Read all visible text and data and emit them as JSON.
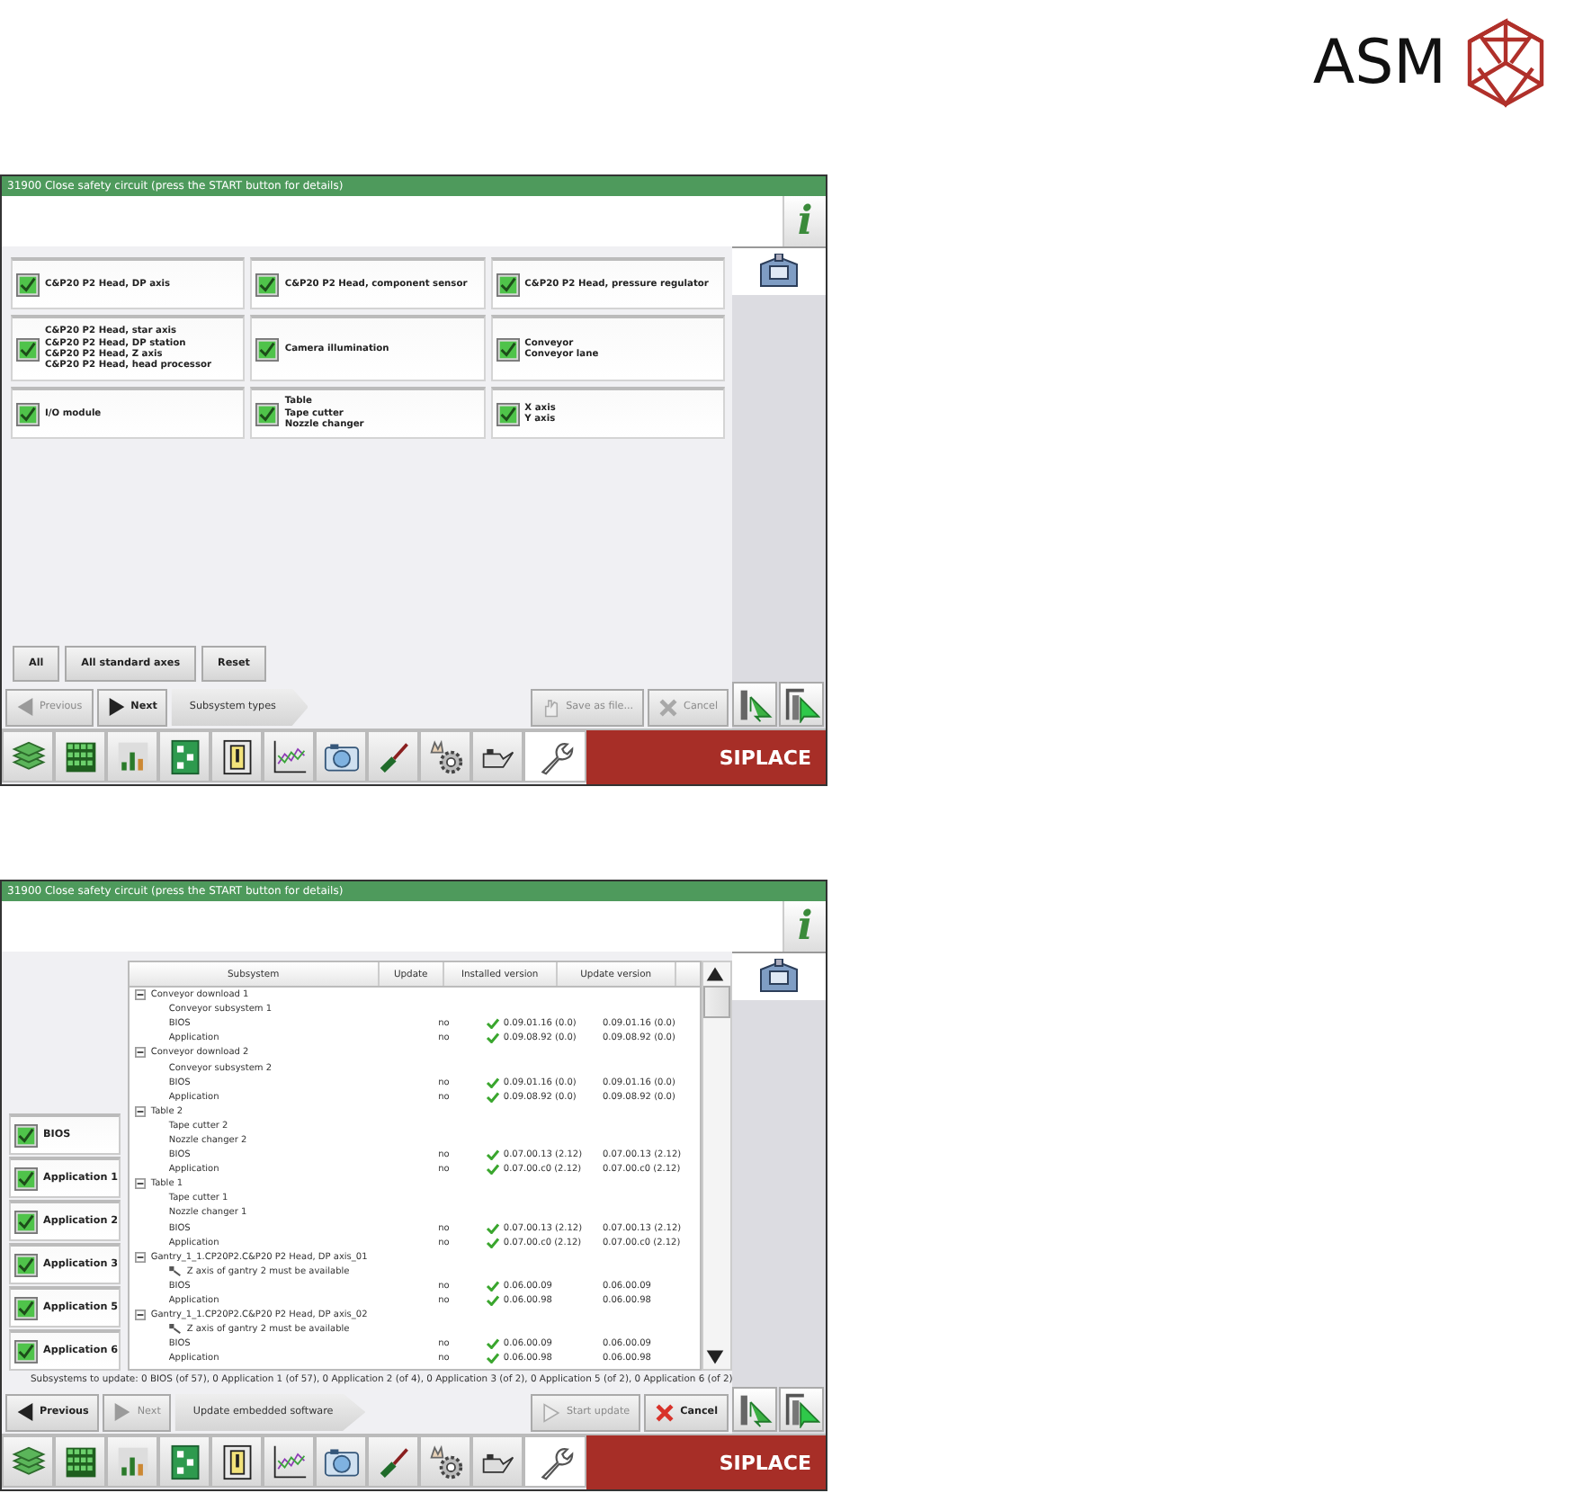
{
  "logo": {
    "text": "ASM"
  },
  "screens": [
    {
      "kind": "subsystem_types",
      "title": "31900 Close safety circuit (press the START button for details)",
      "info": "i",
      "tiles": [
        {
          "checked": true,
          "lines": [
            "C&P20 P2 Head, DP axis"
          ]
        },
        {
          "checked": true,
          "lines": [
            "C&P20 P2 Head, component sensor"
          ]
        },
        {
          "checked": true,
          "lines": [
            "C&P20 P2 Head, pressure regulator"
          ]
        },
        {
          "checked": true,
          "lines": [
            "C&P20 P2 Head, star axis",
            "C&P20 P2 Head, DP station",
            "C&P20 P2 Head, Z axis",
            "C&P20 P2 Head, head processor"
          ]
        },
        {
          "checked": true,
          "lines": [
            "Camera illumination"
          ]
        },
        {
          "checked": true,
          "lines": [
            "Conveyor",
            "Conveyor lane"
          ]
        },
        {
          "checked": true,
          "lines": [
            "I/O module"
          ]
        },
        {
          "checked": true,
          "lines": [
            "Table",
            "Tape cutter",
            "Nozzle changer"
          ]
        },
        {
          "checked": true,
          "lines": [
            "X axis",
            "Y axis"
          ]
        }
      ],
      "select_buttons": [
        "All",
        "All standard axes",
        "Reset"
      ],
      "nav": {
        "previous": {
          "label": "Previous",
          "disabled": true
        },
        "next": {
          "label": "Next",
          "disabled": false
        },
        "step": "Subsystem types",
        "actions": [
          {
            "kind": "save",
            "label": "Save as file...",
            "disabled": true
          },
          {
            "kind": "cancel",
            "label": "Cancel",
            "disabled": true
          }
        ]
      },
      "taskbar": [
        {
          "kind": "stack",
          "selected": false
        },
        {
          "kind": "grid",
          "selected": false
        },
        {
          "kind": "bars",
          "selected": false
        },
        {
          "kind": "board",
          "selected": false
        },
        {
          "kind": "door",
          "selected": false
        },
        {
          "kind": "linechart",
          "selected": false
        },
        {
          "kind": "camera",
          "selected": false
        },
        {
          "kind": "screwdriver",
          "selected": false
        },
        {
          "kind": "handgear",
          "selected": false
        },
        {
          "kind": "oilcan",
          "selected": false
        },
        {
          "kind": "wrench",
          "selected": true
        }
      ],
      "brand": "SIPLACE"
    },
    {
      "kind": "embedded_update",
      "title": "31900 Close safety circuit (press the START button for details)",
      "info": "i",
      "options": [
        {
          "label": "BIOS",
          "checked": true
        },
        {
          "label": "Application 1",
          "checked": true
        },
        {
          "label": "Application 2",
          "checked": true
        },
        {
          "label": "Application 3",
          "checked": true
        },
        {
          "label": "Application 5",
          "checked": true
        },
        {
          "label": "Application 6",
          "checked": true
        }
      ],
      "table": {
        "columns": [
          "Subsystem",
          "Update",
          "Installed version",
          "Update version"
        ],
        "rows": [
          {
            "name": "Conveyor download 1",
            "expanded": true,
            "children": [
              {
                "kind": "node",
                "name": "Conveyor subsystem 1"
              },
              {
                "kind": "module",
                "name": "BIOS",
                "update": "no",
                "installed": "0.09.01.16 (0.0)",
                "update_version": "0.09.01.16 (0.0)"
              },
              {
                "kind": "module",
                "name": "Application",
                "update": "no",
                "installed": "0.09.08.92 (0.0)",
                "update_version": "0.09.08.92 (0.0)"
              }
            ]
          },
          {
            "name": "Conveyor download 2",
            "expanded": true,
            "children": [
              {
                "kind": "node",
                "name": "Conveyor subsystem 2"
              },
              {
                "kind": "module",
                "name": "BIOS",
                "update": "no",
                "installed": "0.09.01.16 (0.0)",
                "update_version": "0.09.01.16 (0.0)"
              },
              {
                "kind": "module",
                "name": "Application",
                "update": "no",
                "installed": "0.09.08.92 (0.0)",
                "update_version": "0.09.08.92 (0.0)"
              }
            ]
          },
          {
            "name": "Table 2",
            "expanded": true,
            "children": [
              {
                "kind": "node",
                "name": "Tape cutter 2"
              },
              {
                "kind": "node",
                "name": "Nozzle changer 2"
              },
              {
                "kind": "module",
                "name": "BIOS",
                "update": "no",
                "installed": "0.07.00.13 (2.12)",
                "update_version": "0.07.00.13 (2.12)"
              },
              {
                "kind": "module",
                "name": "Application",
                "update": "no",
                "installed": "0.07.00.c0 (2.12)",
                "update_version": "0.07.00.c0 (2.12)"
              }
            ]
          },
          {
            "name": "Table 1",
            "expanded": true,
            "children": [
              {
                "kind": "node",
                "name": "Tape cutter 1"
              },
              {
                "kind": "node",
                "name": "Nozzle changer 1"
              },
              {
                "kind": "module",
                "name": "BIOS",
                "update": "no",
                "installed": "0.07.00.13 (2.12)",
                "update_version": "0.07.00.13 (2.12)"
              },
              {
                "kind": "module",
                "name": "Application",
                "update": "no",
                "installed": "0.07.00.c0 (2.12)",
                "update_version": "0.07.00.c0 (2.12)"
              }
            ]
          },
          {
            "name": "Gantry_1_1.CP20P2.C&P20 P2 Head, DP axis_01",
            "expanded": true,
            "children": [
              {
                "kind": "warning",
                "name": "Z axis of gantry 2 must be available"
              },
              {
                "kind": "module",
                "name": "BIOS",
                "update": "no",
                "installed": "0.06.00.09",
                "update_version": "0.06.00.09"
              },
              {
                "kind": "module",
                "name": "Application",
                "update": "no",
                "installed": "0.06.00.98",
                "update_version": "0.06.00.98"
              }
            ]
          },
          {
            "name": "Gantry_1_1.CP20P2.C&P20 P2 Head, DP axis_02",
            "expanded": true,
            "children": [
              {
                "kind": "warning",
                "name": "Z axis of gantry 2 must be available"
              },
              {
                "kind": "module",
                "name": "BIOS",
                "update": "no",
                "installed": "0.06.00.09",
                "update_version": "0.06.00.09"
              },
              {
                "kind": "module",
                "name": "Application",
                "update": "no",
                "installed": "0.06.00.98",
                "update_version": "0.06.00.98"
              }
            ]
          }
        ]
      },
      "status": "Subsystems to update: 0 BIOS (of 57), 0 Application 1 (of 57), 0 Application 2 (of 4), 0 Application 3 (of 2), 0 Application 5 (of 2), 0 Application 6 (of 2)",
      "nav": {
        "previous": {
          "label": "Previous",
          "disabled": false
        },
        "next": {
          "label": "Next",
          "disabled": true
        },
        "step": "Update embedded software",
        "actions": [
          {
            "kind": "start",
            "label": "Start update",
            "disabled": true
          },
          {
            "kind": "cancel",
            "label": "Cancel",
            "disabled": false
          }
        ]
      },
      "taskbar": [
        {
          "kind": "stack",
          "selected": false
        },
        {
          "kind": "grid",
          "selected": false
        },
        {
          "kind": "bars",
          "selected": false
        },
        {
          "kind": "board",
          "selected": false
        },
        {
          "kind": "door",
          "selected": false
        },
        {
          "kind": "linechart",
          "selected": false
        },
        {
          "kind": "camera",
          "selected": false
        },
        {
          "kind": "screwdriver",
          "selected": false
        },
        {
          "kind": "handgear",
          "selected": false
        },
        {
          "kind": "oilcan",
          "selected": false
        },
        {
          "kind": "wrench",
          "selected": true
        }
      ],
      "brand": "SIPLACE"
    }
  ]
}
